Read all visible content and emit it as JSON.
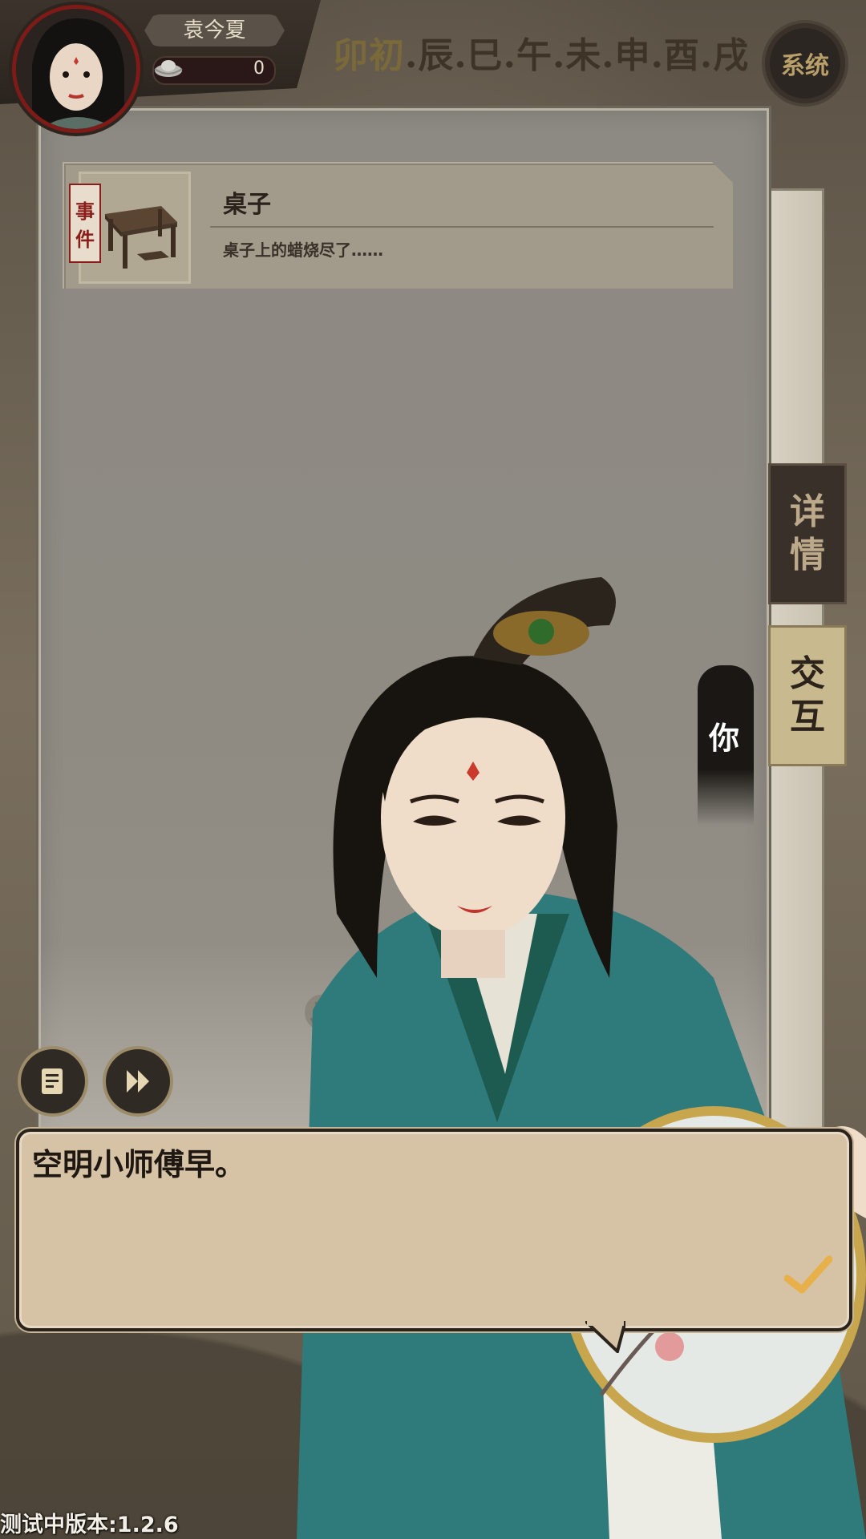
{
  "hud": {
    "player_name": "袁今夏",
    "silver": "0",
    "system_label": "系统",
    "time_current": "卯初",
    "time_rest": ".辰.巳.午.未.申.酉.戌"
  },
  "event": {
    "tag": [
      "事",
      "件"
    ],
    "title": "桌子",
    "description": "桌子上的蜡烧尽了……"
  },
  "side_tabs": {
    "detail": [
      "详",
      "情"
    ],
    "interact": [
      "交",
      "互"
    ]
  },
  "speaker": "你",
  "dialogue": {
    "text": "空明小师傅早。"
  },
  "version": "测试中版本:1.2.6",
  "colors": {
    "accent_red": "#7e1b18",
    "dialog_bg": "#d6c3a6",
    "panel": "#8d8a83",
    "confirm": "#e8b04a"
  }
}
